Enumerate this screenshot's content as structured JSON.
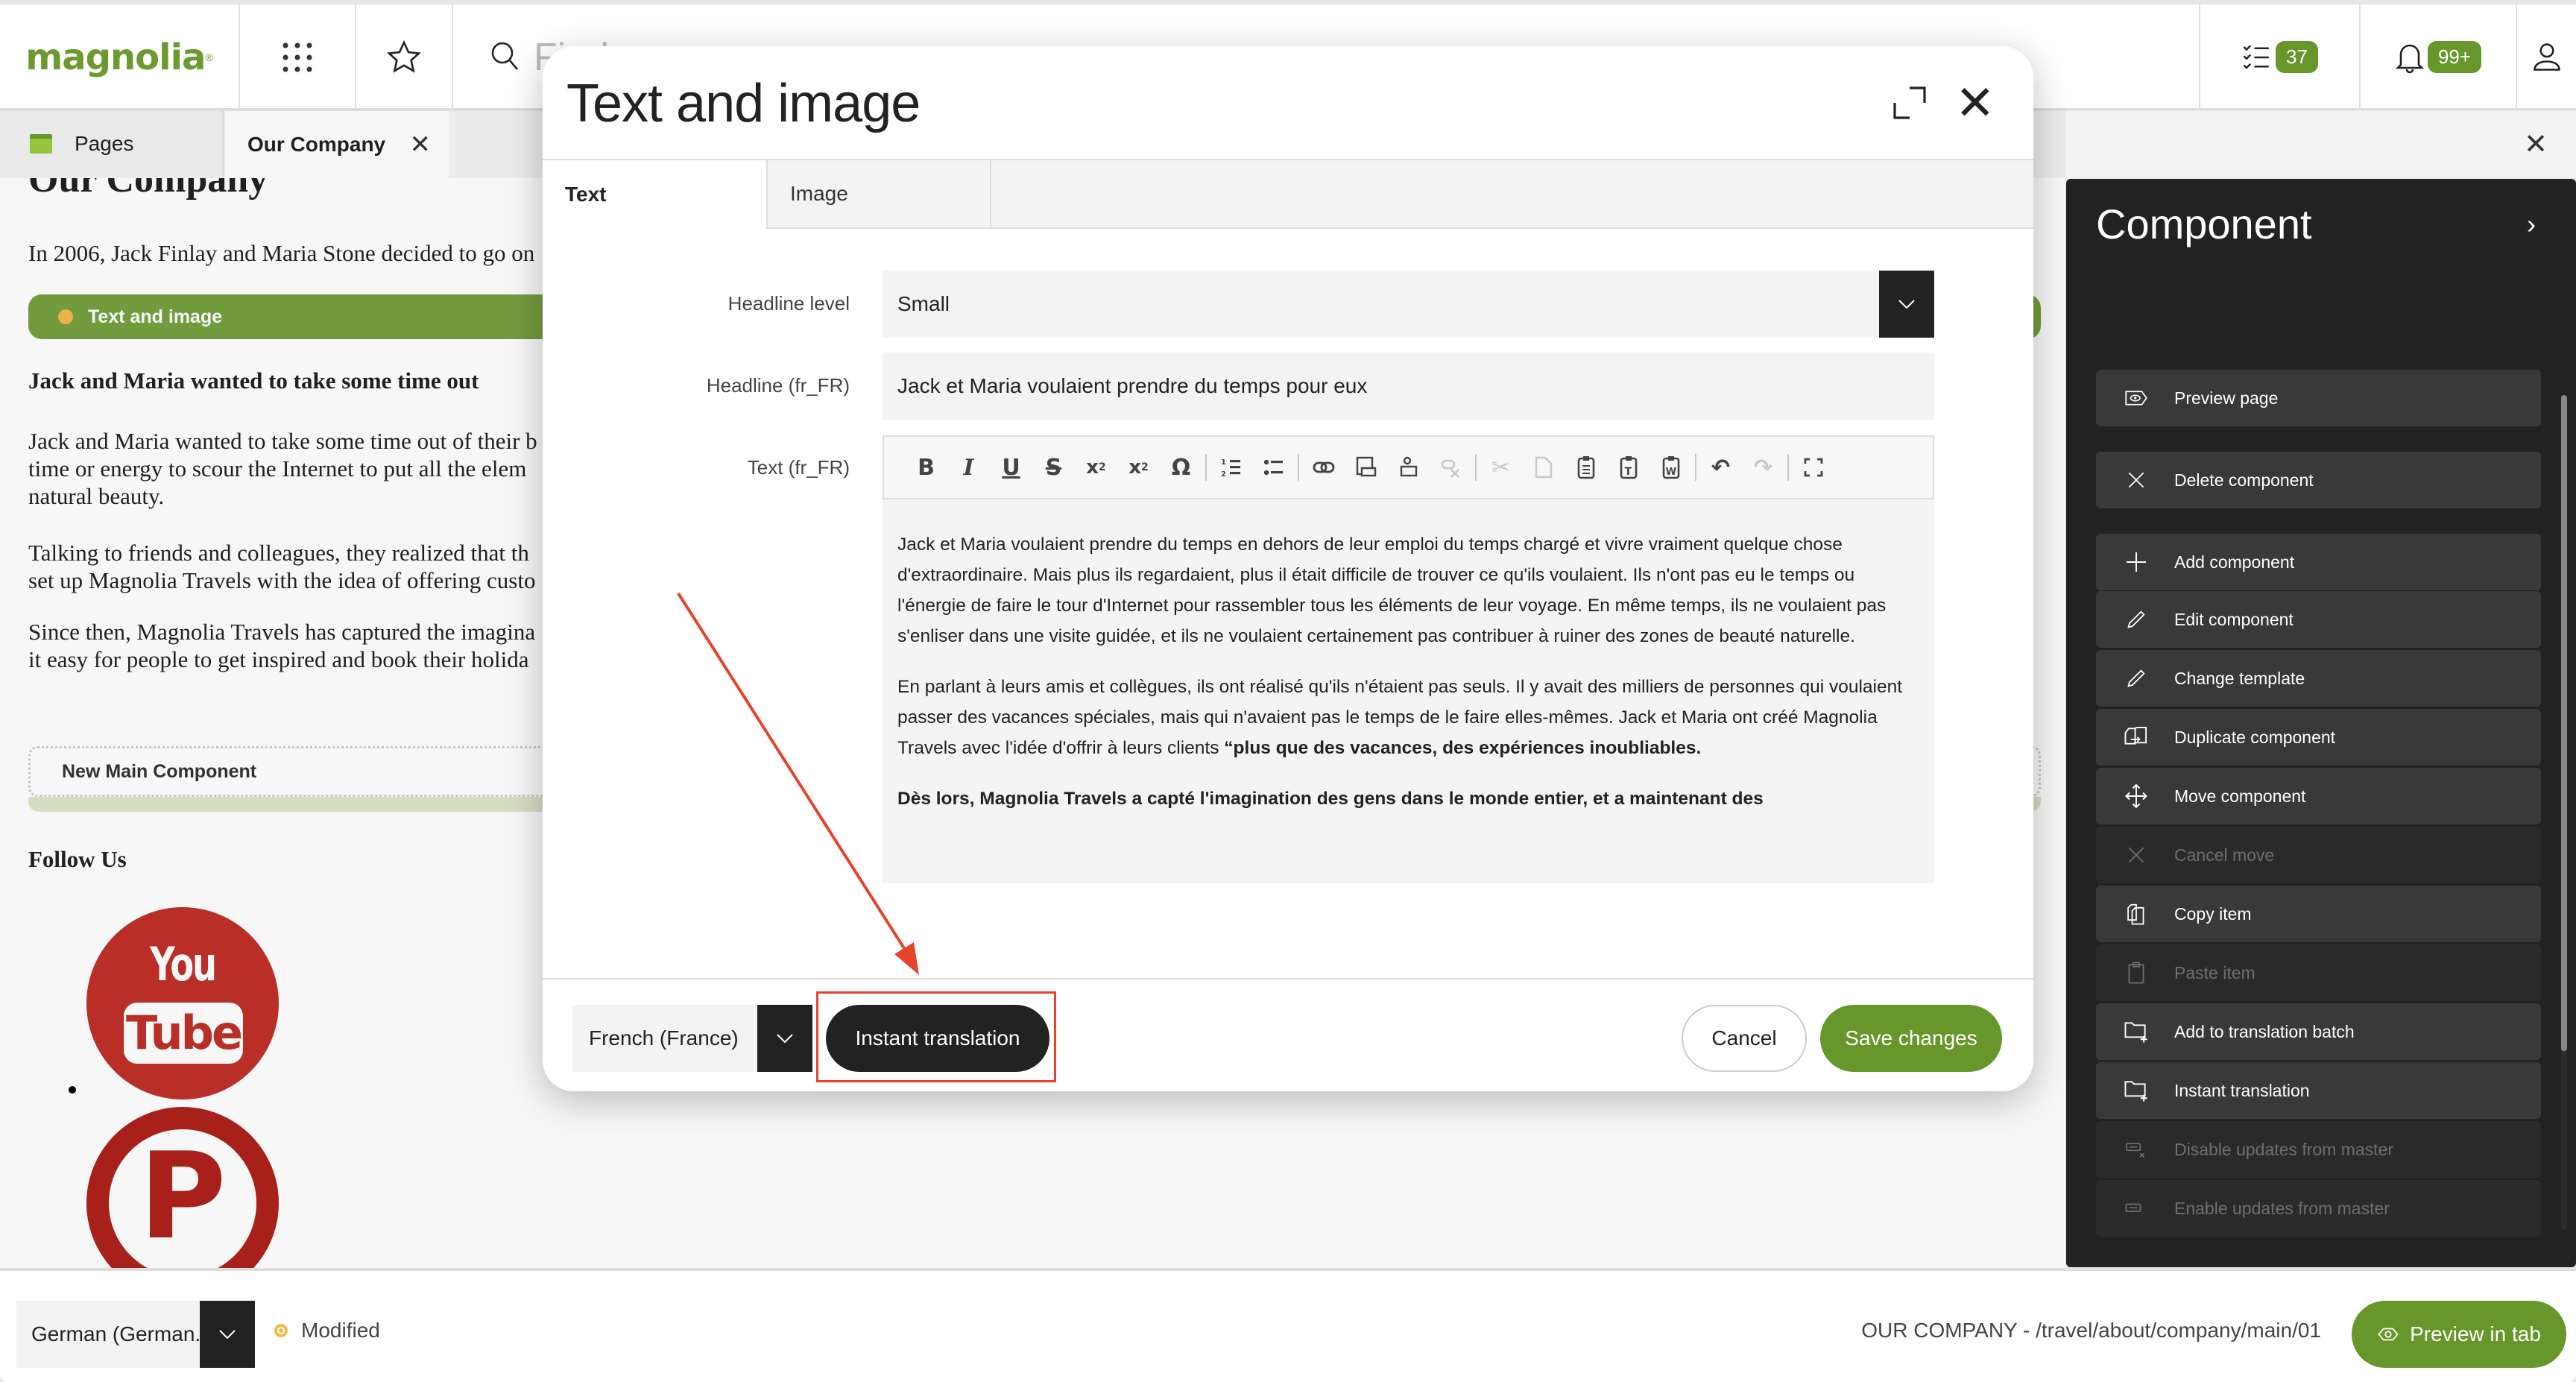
{
  "topbar": {
    "logo": "magnolia",
    "logo_mark": "®",
    "search_placeholder": "Find",
    "tasks_count": "37",
    "notifications_count": "99+"
  },
  "tabs": {
    "pages_label": "Pages",
    "active_label": "Our Company"
  },
  "page_preview": {
    "title": "Our Company",
    "intro": "In 2006, Jack Finlay and Maria Stone decided to go on",
    "component_bar_label": "Text and image",
    "headline": "Jack and Maria wanted to take some time out",
    "paragraphs": [
      [
        "Jack and Maria wanted to take some time out of their b",
        "time or energy to scour the Internet to put all the elem",
        "natural beauty."
      ],
      [
        "Talking to friends and colleagues, they realized that th",
        "set up Magnolia Travels with the idea of offering custo"
      ],
      [
        "Since then, Magnolia Travels has captured the imagina",
        "it easy for people to get inspired and book their holida"
      ]
    ],
    "new_component_label": "New Main Component",
    "follow_us": "Follow Us",
    "social": [
      "YouTube",
      "Pinterest"
    ]
  },
  "dialog": {
    "title": "Text and image",
    "tabs": [
      {
        "label": "Text",
        "active": true
      },
      {
        "label": "Image",
        "active": false
      }
    ],
    "fields": {
      "headline_level": {
        "label": "Headline level",
        "value": "Small"
      },
      "headline": {
        "label": "Headline (fr_FR)",
        "value": "Jack et Maria voulaient prendre du temps pour eux"
      },
      "text": {
        "label": "Text (fr_FR)"
      }
    },
    "toolbar": [
      "bold",
      "italic",
      "underline",
      "strikethrough",
      "subscript",
      "superscript",
      "special-character",
      "numbered-list",
      "bulleted-list",
      "link",
      "internal-link",
      "asset-link",
      "unlink",
      "cut",
      "copy",
      "paste",
      "paste-as-text",
      "paste-from-word",
      "undo",
      "redo",
      "maximize"
    ],
    "text_body": {
      "p1": "Jack et Maria voulaient prendre du temps en dehors de leur emploi du temps chargé et vivre vraiment quelque chose d'extraordinaire. Mais plus ils regardaient, plus il était difficile de trouver ce qu'ils voulaient. Ils n'ont pas eu le temps ou l'énergie de faire le tour d'Internet pour rassembler tous les éléments de leur voyage. En même temps, ils ne voulaient pas s'enliser dans une visite guidée, et ils ne voulaient certainement pas contribuer à ruiner des zones de beauté naturelle.",
      "p2_normal": "En parlant à leurs amis et collègues, ils ont réalisé qu'ils n'étaient pas seuls. Il y avait des milliers de personnes qui voulaient passer des vacances spéciales, mais qui n'avaient pas le temps de le faire elles-mêmes. Jack et Maria ont créé Magnolia Travels avec l'idée d'offrir à leurs clients ",
      "p2_bold": "“plus que des vacances, des expériences inoubliables.",
      "p3_bold": "Dès lors, Magnolia Travels a capté l'imagination des gens dans le monde entier, et a maintenant des"
    },
    "footer": {
      "language": "French (France)",
      "instant_translation": "Instant translation",
      "cancel": "Cancel",
      "save": "Save changes"
    }
  },
  "panel": {
    "title": "Component",
    "actions": [
      {
        "label": "Preview page",
        "icon": "preview-icon",
        "enabled": true
      },
      {
        "label": "Delete component",
        "icon": "close-icon",
        "enabled": true
      },
      {
        "label": "Add component",
        "icon": "plus-icon",
        "enabled": true
      },
      {
        "label": "Edit component",
        "icon": "pencil-icon",
        "enabled": true
      },
      {
        "label": "Change template",
        "icon": "pencil-icon",
        "enabled": true
      },
      {
        "label": "Duplicate component",
        "icon": "duplicate-icon",
        "enabled": true
      },
      {
        "label": "Move component",
        "icon": "move-icon",
        "enabled": true
      },
      {
        "label": "Cancel move",
        "icon": "close-icon",
        "enabled": false
      },
      {
        "label": "Copy item",
        "icon": "copy-icon",
        "enabled": true
      },
      {
        "label": "Paste item",
        "icon": "paste-icon",
        "enabled": false
      },
      {
        "label": "Add to translation batch",
        "icon": "folder-plus-icon",
        "enabled": true
      },
      {
        "label": "Instant translation",
        "icon": "folder-plus-icon",
        "enabled": true
      },
      {
        "label": "Disable updates from master",
        "icon": "unlink-master-icon",
        "enabled": false
      },
      {
        "label": "Enable updates from master",
        "icon": "link-master-icon",
        "enabled": false
      }
    ]
  },
  "bottombar": {
    "locale": "German (German...",
    "status": "Modified",
    "path": "OUR COMPANY - /travel/about/company/main/01",
    "preview_button": "Preview in tab"
  },
  "colors": {
    "brand_green": "#67962b",
    "component_bar": "#76a040",
    "status_modified": "#f2b84b",
    "annotation_red": "#e5432a",
    "panel_bg": "#222222"
  }
}
